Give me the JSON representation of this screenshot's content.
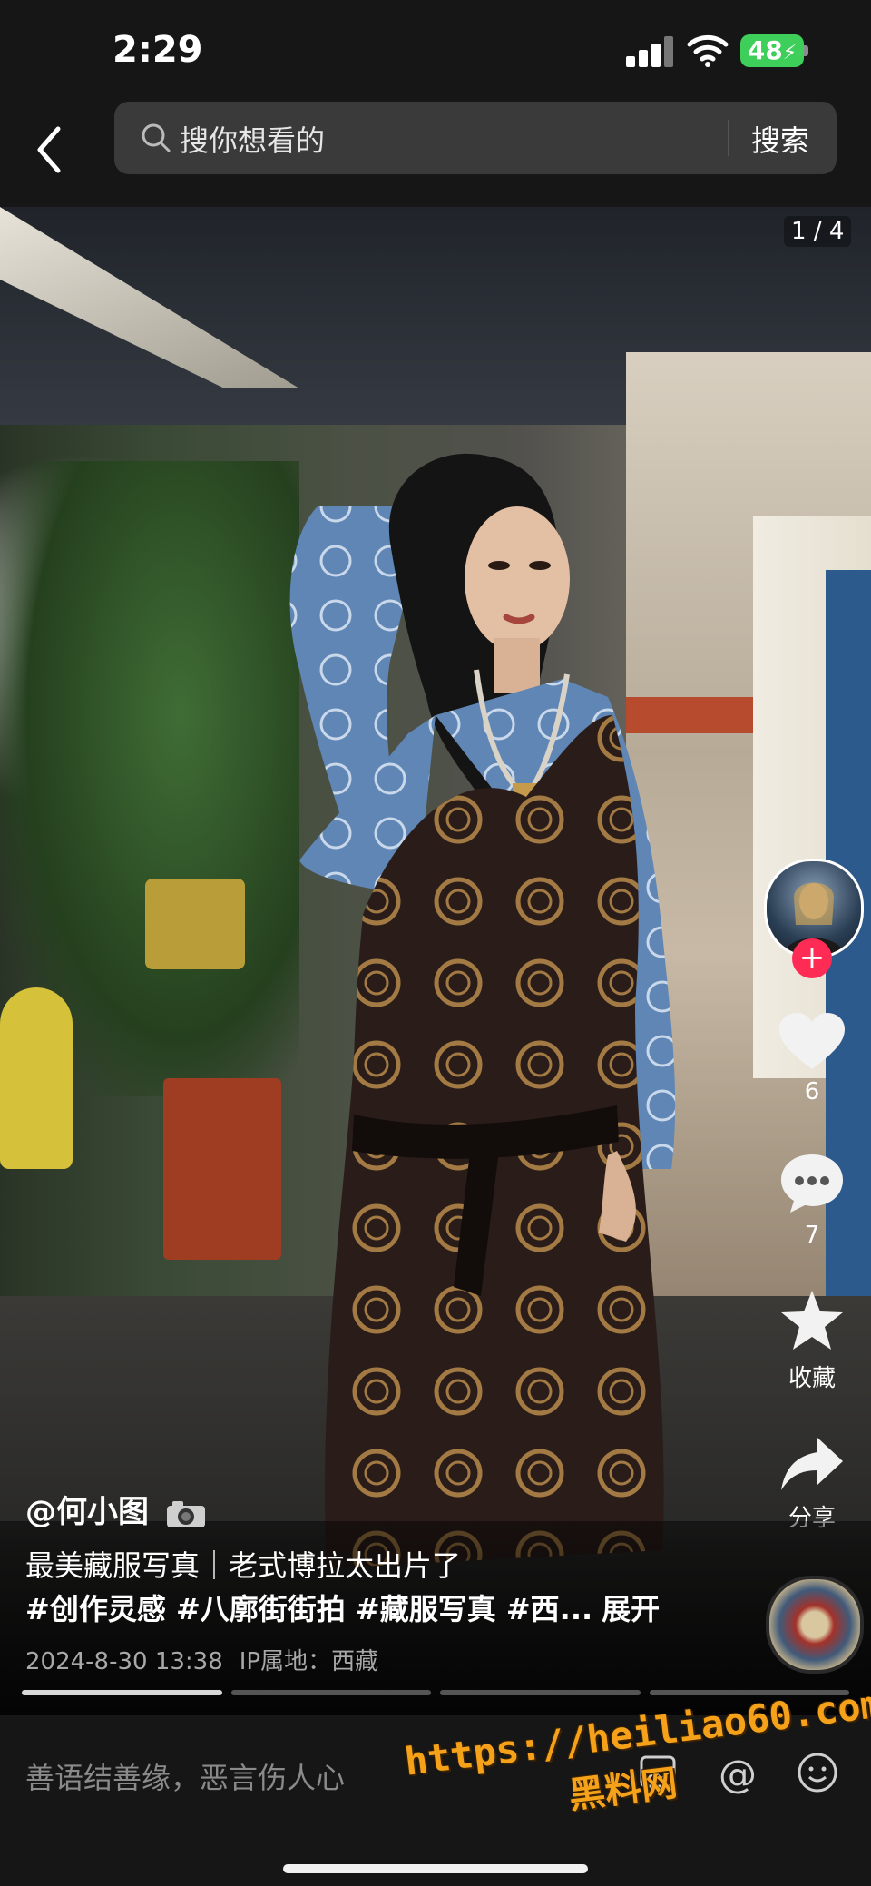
{
  "status_bar": {
    "time": "2:29",
    "battery": "48"
  },
  "search": {
    "placeholder": "搜你想看的",
    "button_label": "搜索"
  },
  "post": {
    "page_indicator": "1 / 4",
    "author": "@何小图",
    "title": "最美藏服写真｜老式博拉太出片了",
    "tags": "#创作灵感 #八廓街街拍 #藏服写真 #西...",
    "expand_label": "展开",
    "date": "2024-8-30 13:38",
    "ip_location": "IP属地：西藏",
    "image_count": 4,
    "current_image": 1
  },
  "actions": {
    "likes": "6",
    "comments": "7",
    "favorite_label": "收藏",
    "share_label": "分享"
  },
  "bottom": {
    "comment_placeholder": "善语结善缘，恶言伤人心"
  },
  "watermark": {
    "url": "https://heiliao60.com",
    "name": "黑料网"
  },
  "colors": {
    "follow": "#fe2c55",
    "battery": "#3ecf5a",
    "watermark": "#f5a21a"
  }
}
